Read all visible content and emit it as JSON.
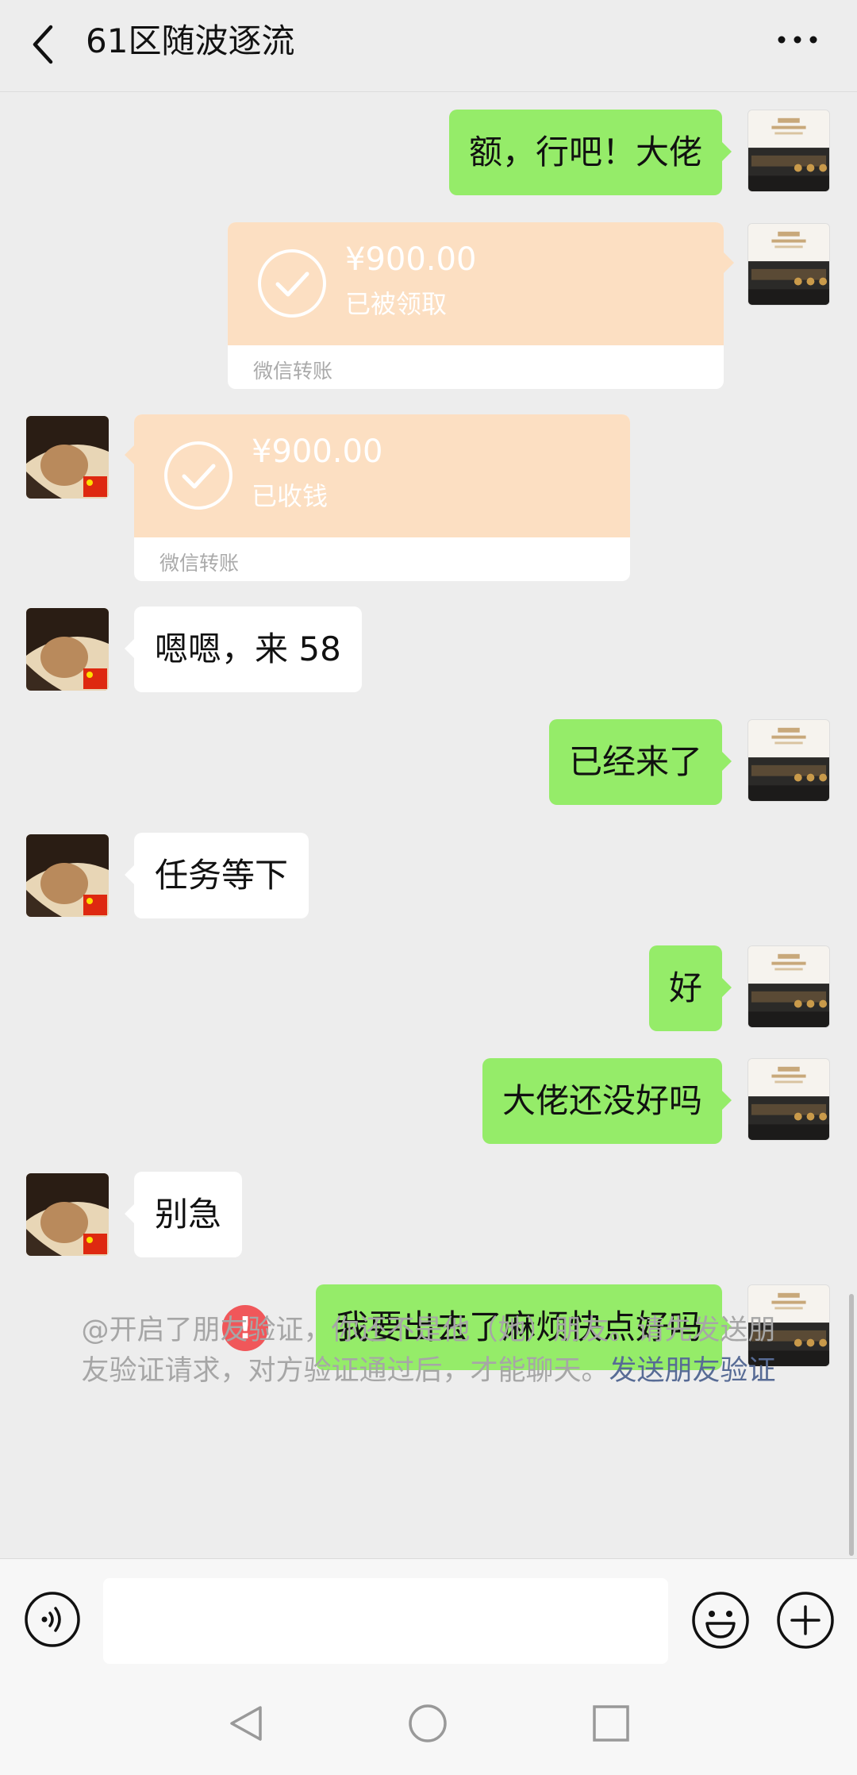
{
  "header": {
    "title": "61区随波逐流"
  },
  "messages": {
    "m1": "额，行吧！大佬",
    "t1": {
      "amount": "¥900.00",
      "status": "已被领取",
      "label": "微信转账"
    },
    "t2": {
      "amount": "¥900.00",
      "status": "已收钱",
      "label": "微信转账"
    },
    "m3": "嗯嗯，来 58",
    "m4": "已经来了",
    "m5": "任务等下",
    "m6": "好",
    "m7": "大佬还没好吗",
    "m8": "别急",
    "m9": "我要出去了麻烦快点好吗",
    "error_mark": "!"
  },
  "notice": {
    "text": "@开启了朋友验证，你还不是他（她）朋友。请先发送朋友验证请求，对方验证通过后，才能聊天。",
    "link": "发送朋友验证"
  },
  "input": {
    "placeholder": ""
  },
  "icons": {
    "back": "back-arrow-icon",
    "more": "more-dots-icon",
    "voice": "voice-icon",
    "emoji": "emoji-icon",
    "plus": "plus-icon",
    "check": "check-circle-icon",
    "nav_back": "triangle-back-icon",
    "nav_home": "circle-home-icon",
    "nav_recent": "square-recent-icon"
  },
  "colors": {
    "sent_bubble": "#95ec69",
    "recv_bubble": "#ffffff",
    "transfer": "#fcdfc2",
    "link": "#576b95",
    "error": "#f0575a"
  }
}
